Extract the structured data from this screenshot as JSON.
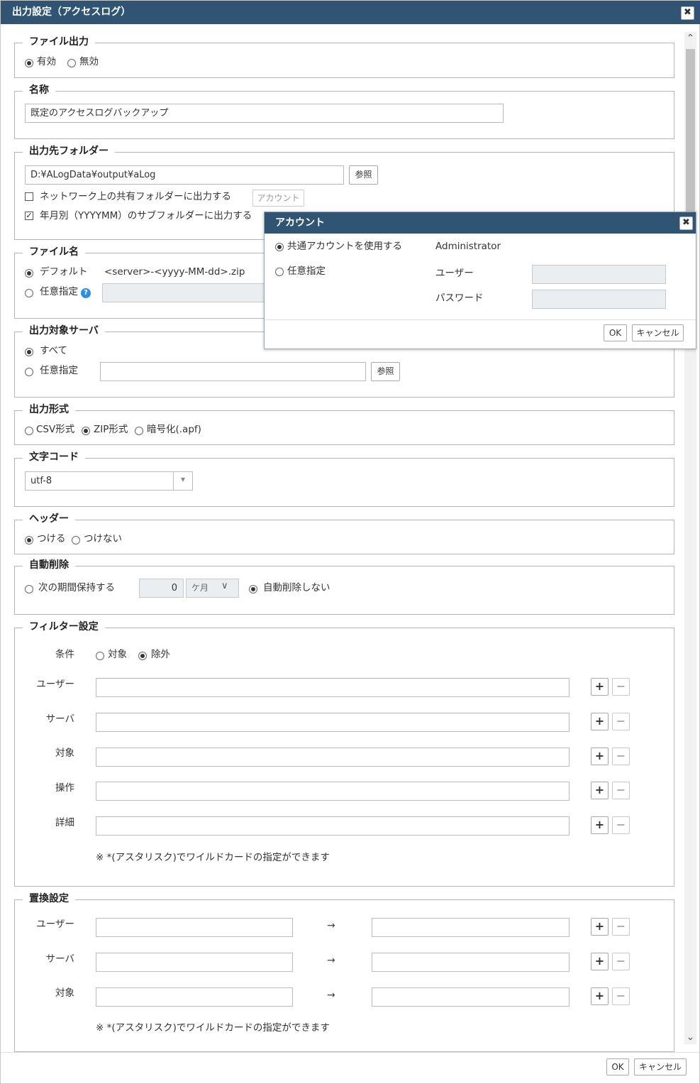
{
  "window": {
    "title": "出力設定（アクセスログ）",
    "close_icon": "✖"
  },
  "file_output": {
    "legend": "ファイル出力",
    "enabled_label": "有効",
    "disabled_label": "無効",
    "selected": "有効"
  },
  "name": {
    "legend": "名称",
    "value": "既定のアクセスログバックアップ"
  },
  "folder": {
    "legend": "出力先フォルダー",
    "path": "D:¥ALogData¥output¥aLog",
    "browse_label": "参照",
    "share_label": "ネットワーク上の共有フォルダーに出力する",
    "share_checked": false,
    "account_label": "アカウント",
    "subfolder_label": "年月別（YYYYMM）のサブフォルダーに出力する",
    "subfolder_checked": true
  },
  "filename": {
    "legend": "ファイル名",
    "default_label": "デフォルト",
    "default_value": "<server>-<yyyy-MM-dd>.zip",
    "custom_label": "任意指定",
    "help_icon": "?",
    "selected": "デフォルト",
    "custom_value": ""
  },
  "servers": {
    "legend": "出力対象サーバ",
    "all_label": "すべて",
    "custom_label": "任意指定",
    "selected": "すべて",
    "custom_value": "",
    "browse_label": "参照"
  },
  "format": {
    "legend": "出力形式",
    "options": [
      "CSV形式",
      "ZIP形式",
      "暗号化(.apf)"
    ],
    "selected": "ZIP形式"
  },
  "encoding": {
    "legend": "文字コード",
    "value": "utf-8",
    "dropdown_icon": "▾"
  },
  "header": {
    "legend": "ヘッダー",
    "on_label": "つける",
    "off_label": "つけない",
    "selected": "つける"
  },
  "auto_delete": {
    "legend": "自動削除",
    "keep_label": "次の期間保持する",
    "period_value": "0",
    "unit": "ケ月",
    "unit_icon": "∨",
    "none_label": "自動削除しない",
    "selected": "自動削除しない"
  },
  "filter": {
    "legend": "フィルター設定",
    "condition_label": "条件",
    "include_label": "対象",
    "exclude_label": "除外",
    "selected": "除外",
    "rows": [
      "ユーザー",
      "サーバ",
      "対象",
      "操作",
      "詳細"
    ],
    "note": "※ *(アスタリスク)でワイルドカードの指定ができます"
  },
  "replace": {
    "legend": "置換設定",
    "rows": [
      "ユーザー",
      "サーバ",
      "対象"
    ],
    "arrow": "→",
    "note": "※ *(アスタリスク)でワイルドカードの指定ができます"
  },
  "buttons": {
    "plus": "+",
    "minus": "−",
    "ok": "OK",
    "cancel": "キャンセル"
  },
  "scrollbar": {
    "up_icon": "⌃",
    "down_icon": "⌄"
  },
  "account_popup": {
    "title": "アカウント",
    "close_icon": "✖",
    "shared_label": "共通アカウントを使用する",
    "shared_value": "Administrator",
    "custom_label": "任意指定",
    "user_label": "ユーザー",
    "password_label": "パスワード",
    "selected": "共通アカウントを使用する",
    "ok": "OK",
    "cancel": "キャンセル"
  }
}
